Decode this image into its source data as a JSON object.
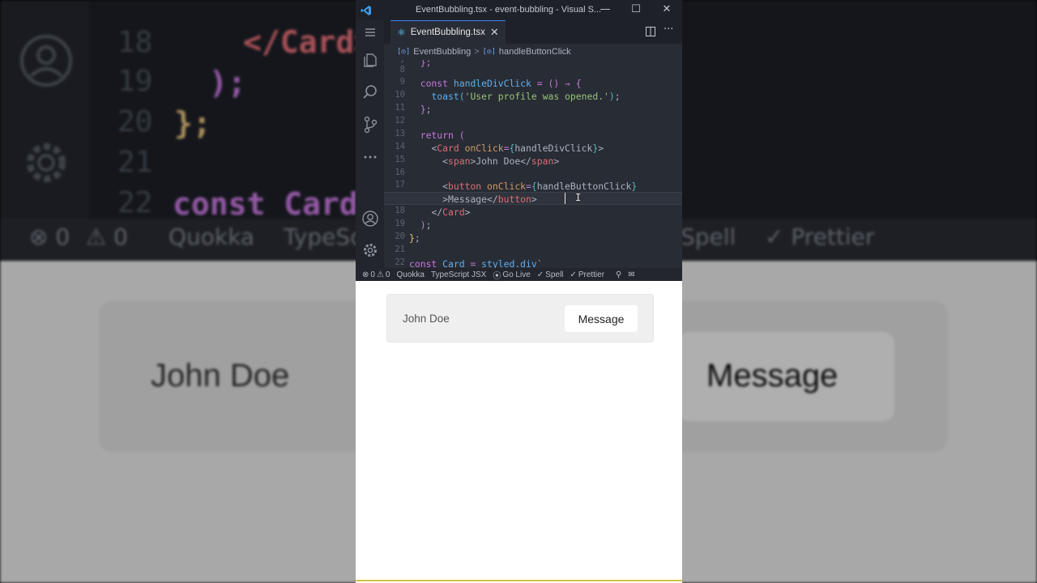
{
  "window": {
    "title": "EventBubbling.tsx - event-bubbling - Visual S...",
    "minimize": "—",
    "maximize": "☐",
    "close": "✕"
  },
  "tab": {
    "label": "EventBubbling.tsx",
    "close": "✕"
  },
  "breadcrumb": {
    "items": [
      "EventBubbling",
      "handleButtonClick"
    ],
    "separator": ">",
    "symbol_glyph": "[◎]"
  },
  "editor": {
    "lines": [
      {
        "n": "7",
        "text": "  };"
      },
      {
        "n": "8",
        "text": ""
      },
      {
        "n": "9",
        "text": "  const handleDivClick = () ⇒ {"
      },
      {
        "n": "10",
        "text": "    toast('User profile was opened.');"
      },
      {
        "n": "11",
        "text": "  };"
      },
      {
        "n": "12",
        "text": ""
      },
      {
        "n": "13",
        "text": "  return ("
      },
      {
        "n": "14",
        "text": "    <Card onClick={handleDivClick}>"
      },
      {
        "n": "15",
        "text": "      <span>John Doe</span>"
      },
      {
        "n": "16",
        "text": ""
      },
      {
        "n": "17",
        "text": "      <button onClick={handleButtonClick}"
      },
      {
        "n": "",
        "text": "      >Message</button>"
      },
      {
        "n": "18",
        "text": "    </Card>"
      },
      {
        "n": "19",
        "text": "  );"
      },
      {
        "n": "20",
        "text": "};"
      },
      {
        "n": "21",
        "text": ""
      },
      {
        "n": "22",
        "text": "const Card = styled.div`"
      }
    ],
    "cursor_glyph": "I"
  },
  "statusbar": {
    "errors": "0",
    "warnings": "0",
    "items": [
      "Quokka",
      "TypeScript JSX",
      "Go Live",
      "Spell",
      "Prettier"
    ]
  },
  "preview": {
    "card_name": "John Doe",
    "button_label": "Message"
  },
  "background": {
    "line_numbers": [
      "18",
      "19",
      "20",
      "21",
      "22"
    ],
    "code": [
      "</Card>",
      ");",
      "};",
      "const Card"
    ],
    "status": [
      "0",
      "0",
      "Quokka",
      "TypeSc",
      "Spell",
      "Prettier"
    ],
    "card_name": "John Doe",
    "button_label": "Message"
  },
  "colors": {
    "editor_bg": "#282c34",
    "keyword": "#c678dd",
    "function": "#61afef",
    "string": "#98c379",
    "tag": "#e06c75",
    "attribute": "#d19a66",
    "accent": "#3b82f6"
  }
}
